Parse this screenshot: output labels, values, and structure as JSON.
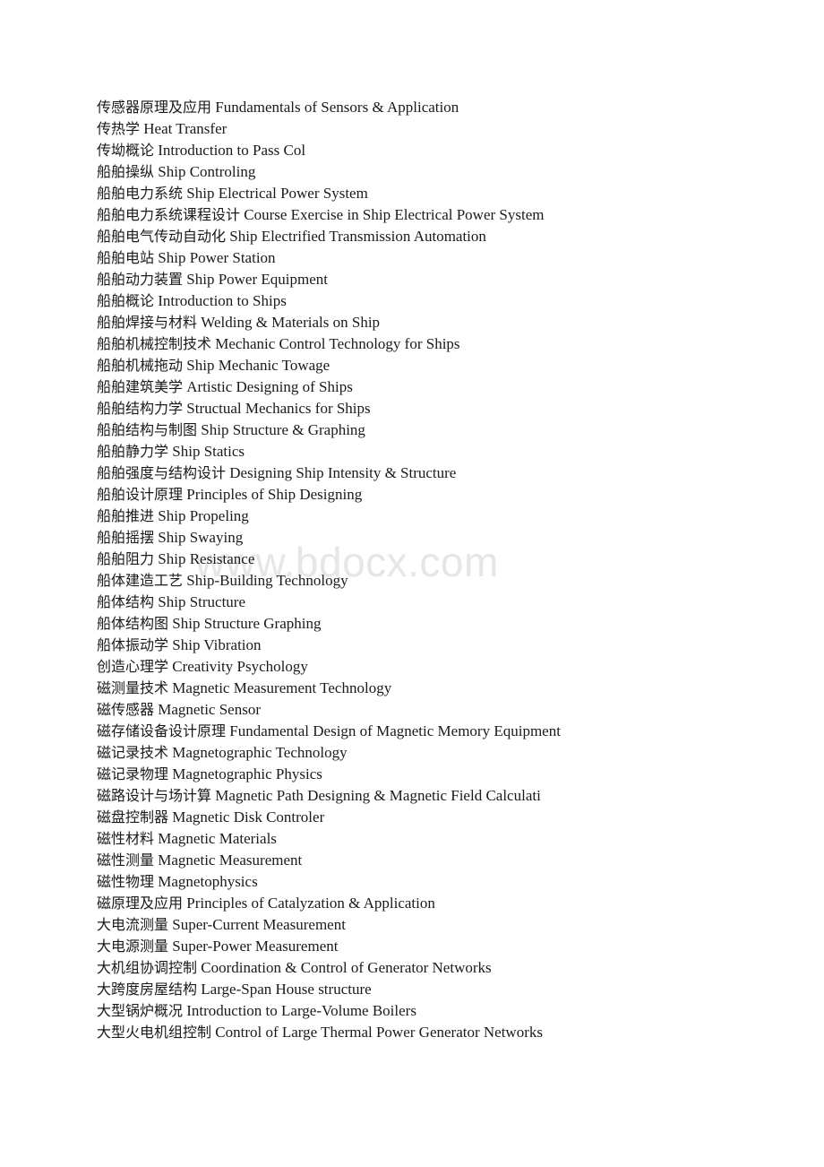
{
  "document": {
    "watermark_text": "www.bdocx.com",
    "watermark_color": "#e6e6e6",
    "text_color": "#1a1a1a",
    "background_color": "#ffffff"
  },
  "glossary": {
    "entries": [
      {
        "zh": "传感器原理及应用",
        "en": "Fundamentals of Sensors & Application"
      },
      {
        "zh": "传热学",
        "en": "Heat Transfer"
      },
      {
        "zh": "传坳概论",
        "en": "Introduction to Pass Col"
      },
      {
        "zh": "船舶操纵",
        "en": "Ship Controling"
      },
      {
        "zh": "船舶电力系统",
        "en": "Ship Electrical Power System"
      },
      {
        "zh": "船舶电力系统课程设计",
        "en": "Course Exercise in Ship Electrical Power System"
      },
      {
        "zh": "船舶电气传动自动化",
        "en": "Ship Electrified Transmission Automation"
      },
      {
        "zh": "船舶电站",
        "en": "Ship Power Station"
      },
      {
        "zh": "船舶动力装置",
        "en": "Ship Power Equipment"
      },
      {
        "zh": "船舶概论",
        "en": "Introduction to Ships"
      },
      {
        "zh": "船舶焊接与材料",
        "en": "Welding & Materials on Ship"
      },
      {
        "zh": "船舶机械控制技术",
        "en": "Mechanic Control Technology for Ships"
      },
      {
        "zh": "船舶机械拖动",
        "en": "Ship Mechanic Towage"
      },
      {
        "zh": "船舶建筑美学",
        "en": "Artistic Designing of Ships"
      },
      {
        "zh": "船舶结构力学",
        "en": "Structual Mechanics for Ships"
      },
      {
        "zh": "船舶结构与制图",
        "en": "Ship Structure & Graphing"
      },
      {
        "zh": "船舶静力学",
        "en": "Ship Statics"
      },
      {
        "zh": "船舶强度与结构设计",
        "en": "Designing Ship Intensity & Structure"
      },
      {
        "zh": "船舶设计原理",
        "en": "Principles of Ship Designing"
      },
      {
        "zh": "船舶推进",
        "en": "Ship Propeling"
      },
      {
        "zh": "船舶摇摆",
        "en": "Ship Swaying"
      },
      {
        "zh": "船舶阻力",
        "en": "Ship Resistance"
      },
      {
        "zh": "船体建造工艺",
        "en": "Ship-Building Technology"
      },
      {
        "zh": "船体结构",
        "en": "Ship Structure"
      },
      {
        "zh": "船体结构图",
        "en": "Ship Structure Graphing"
      },
      {
        "zh": "船体振动学",
        "en": "Ship Vibration"
      },
      {
        "zh": "创造心理学",
        "en": "Creativity Psychology"
      },
      {
        "zh": "磁测量技术",
        "en": "Magnetic Measurement Technology"
      },
      {
        "zh": "磁传感器",
        "en": "Magnetic Sensor"
      },
      {
        "zh": "磁存储设备设计原理",
        "en": "Fundamental Design of Magnetic Memory Equipment"
      },
      {
        "zh": "磁记录技术",
        "en": "Magnetographic Technology"
      },
      {
        "zh": "磁记录物理",
        "en": "Magnetographic Physics"
      },
      {
        "zh": "磁路设计与场计算",
        "en": "Magnetic Path Designing & Magnetic Field Calculati"
      },
      {
        "zh": "磁盘控制器",
        "en": "Magnetic Disk Controler"
      },
      {
        "zh": "磁性材料",
        "en": "Magnetic Materials"
      },
      {
        "zh": "磁性测量",
        "en": "Magnetic Measurement"
      },
      {
        "zh": "磁性物理",
        "en": "Magnetophysics"
      },
      {
        "zh": "磁原理及应用",
        "en": "Principles of Catalyzation & Application"
      },
      {
        "zh": "大电流测量",
        "en": "Super-Current Measurement"
      },
      {
        "zh": "大电源测量",
        "en": "Super-Power Measurement"
      },
      {
        "zh": "大机组协调控制",
        "en": "Coordination & Control of Generator Networks"
      },
      {
        "zh": "大跨度房屋结构",
        "en": "Large-Span House structure"
      },
      {
        "zh": "大型锅炉概况",
        "en": "Introduction to Large-Volume Boilers"
      },
      {
        "zh": "大型火电机组控制",
        "en": "Control of Large Thermal Power Generator Networks"
      }
    ]
  }
}
